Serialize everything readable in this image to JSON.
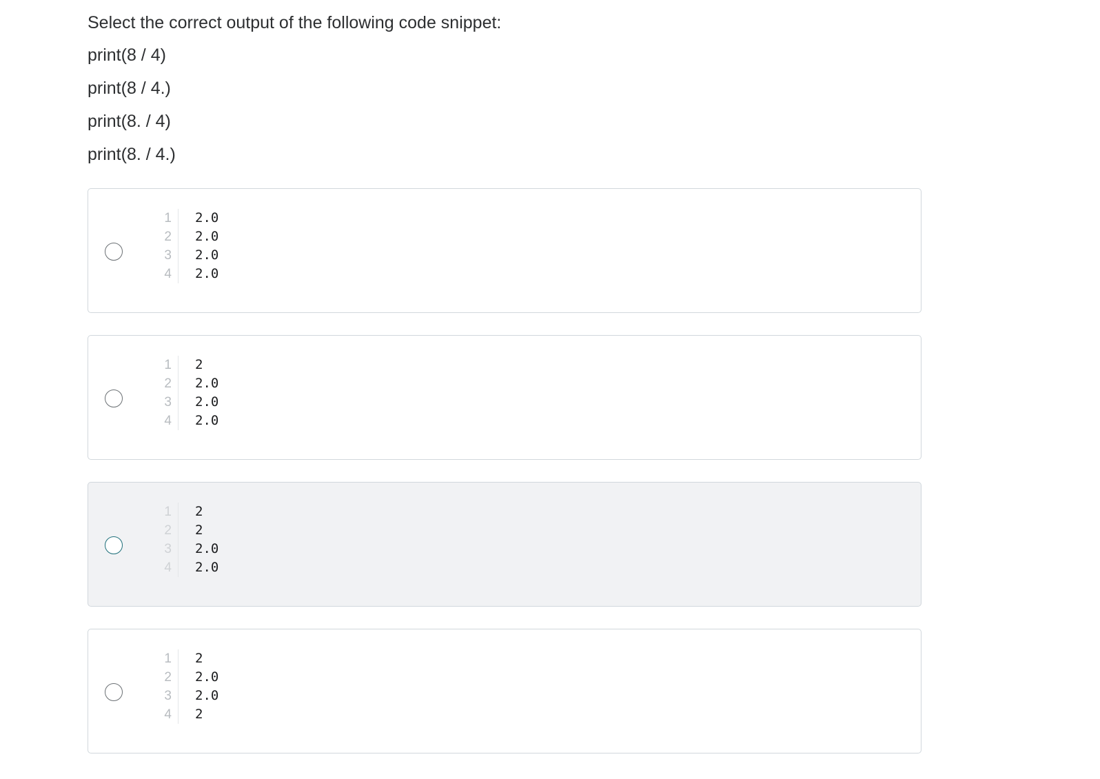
{
  "question": {
    "prompt": "Select the correct output of the following code snippet:",
    "code_lines": [
      "print(8 / 4)",
      "print(8 / 4.)",
      "print(8. / 4)",
      "print(8. / 4.)"
    ]
  },
  "options": [
    {
      "line_numbers": [
        "1",
        "2",
        "3",
        "4"
      ],
      "lines": [
        "2.0",
        "2.0",
        "2.0",
        "2.0"
      ],
      "selected": false,
      "hovered": false
    },
    {
      "line_numbers": [
        "1",
        "2",
        "3",
        "4"
      ],
      "lines": [
        "2",
        "2.0",
        "2.0",
        "2.0"
      ],
      "selected": false,
      "hovered": false
    },
    {
      "line_numbers": [
        "1",
        "2",
        "3",
        "4"
      ],
      "lines": [
        "2",
        "2",
        "2.0",
        "2.0"
      ],
      "selected": false,
      "hovered": true
    },
    {
      "line_numbers": [
        "1",
        "2",
        "3",
        "4"
      ],
      "lines": [
        "2",
        "2.0",
        "2.0",
        "2"
      ],
      "selected": false,
      "hovered": false
    }
  ],
  "colors": {
    "text": "#2d2f31",
    "border": "#d1d7dc",
    "hover_background": "#f1f2f4",
    "radio_hover_border": "#1e6f7a",
    "line_number": "#b8bcc0"
  }
}
